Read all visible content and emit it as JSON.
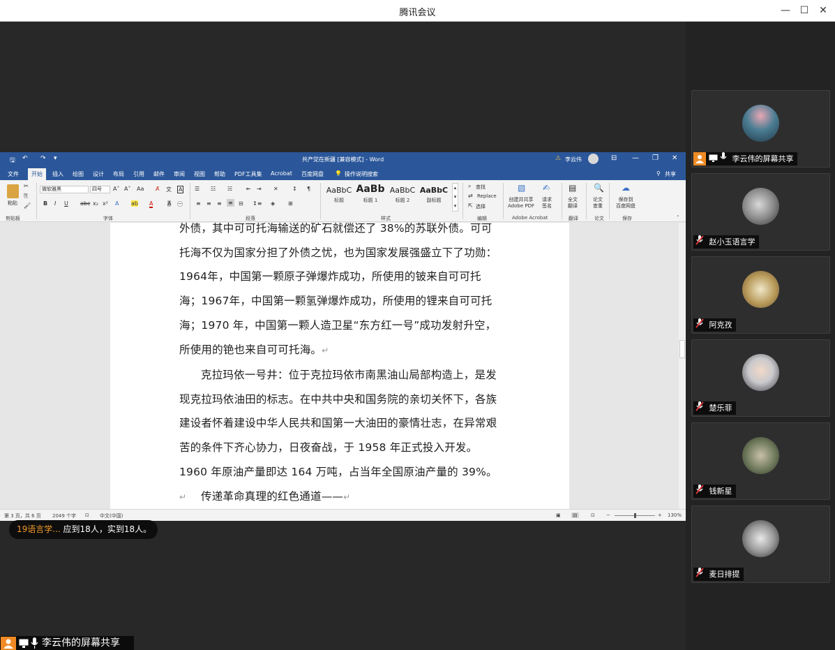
{
  "app": {
    "title": "腾讯会议"
  },
  "window_controls": {
    "minimize": "—",
    "maximize": "☐",
    "close": "✕"
  },
  "word": {
    "doc_title": "共产党在新疆 [兼容模式] - Word",
    "user_name": "李云伟",
    "tabs": [
      "文件",
      "开始",
      "插入",
      "绘图",
      "设计",
      "布局",
      "引用",
      "邮件",
      "审阅",
      "视图",
      "帮助",
      "PDF工具集",
      "Acrobat",
      "百度网盘",
      "操作说明搜索"
    ],
    "active_tab": "开始",
    "share_label": "共享",
    "ribbon": {
      "clipboard": {
        "paste_label": "粘贴",
        "group_label": "剪贴板"
      },
      "font": {
        "font_name": "微软雅黑",
        "font_size": "四号",
        "group_label": "字体"
      },
      "paragraph": {
        "group_label": "段落"
      },
      "styles": {
        "group_label": "样式",
        "items": [
          {
            "sample": "AaBbC",
            "name": "标题"
          },
          {
            "sample": "AaBb",
            "name": "标题 1"
          },
          {
            "sample": "AaBbC",
            "name": "标题 2"
          },
          {
            "sample": "AaBbC",
            "name": "副标题"
          }
        ]
      },
      "editing": {
        "find_label": "查找",
        "replace_label": "Replace",
        "select_label": "选择",
        "group_label": "编辑"
      },
      "acrobat": {
        "create_share": "创建并共享\nAdobe PDF",
        "request_sign": "请求\n签名",
        "group_label": "Adobe Acrobat"
      },
      "translate": {
        "label": "全文\n翻译",
        "group_label": "翻译"
      },
      "paper": {
        "label": "论文\n查重",
        "group_label": "论文"
      },
      "save": {
        "label": "保存到\n百度网盘",
        "group_label": "保存"
      }
    },
    "document": {
      "para1": "外债，其中可可托海输送的矿石就偿还了 38%的苏联外债。可可托海不仅为国家分担了外债之忧，也为国家发展强盛立下了功勋：1964年，中国第一颗原子弹爆炸成功，所使用的铍来自可可托海；1967年，中国第一颗氢弹爆炸成功，所使用的锂来自可可托海；1970 年，中国第一颗人造卫星“东方红一号”成功发射升空，所使用的铯也来自可可托海。",
      "para2": "克拉玛依一号井：位于克拉玛依市南黑油山局部构造上，是发现克拉玛依油田的标志。在中共中央和国务院的亲切关怀下，各族建设者怀着建设中华人民共和国第一大油田的豪情壮志，在异常艰苦的条件下齐心协力，日夜奋战，于 1958 年正式投入开发。1960 年原油产量即达 164 万吨，占当年全国原油产量的 39%。",
      "para3": "传递革命真理的红色通道——",
      "para_mark": "↵"
    },
    "status": {
      "page": "第 3 页，共 6 页",
      "words": "2049 个字",
      "language": "中文(中国)",
      "zoom": "130%"
    }
  },
  "toast": {
    "sender": "19语言学...",
    "message": "应到18人，实到18人。"
  },
  "share_tag": {
    "label": "李云伟的屏幕共享"
  },
  "participants": [
    {
      "name": "李云伟的屏幕共享",
      "sharing": true,
      "color": "#3a6f8a"
    },
    {
      "name": "赵小玉语言学",
      "sharing": false,
      "color": "#8f8f8f"
    },
    {
      "name": "阿克孜",
      "sharing": false,
      "color": "#b89a5a"
    },
    {
      "name": "楚乐菲",
      "sharing": false,
      "color": "#c9c9cc"
    },
    {
      "name": "钱新星",
      "sharing": false,
      "color": "#6f7a5c"
    },
    {
      "name": "麦日排提",
      "sharing": false,
      "color": "#9a9a9a"
    }
  ]
}
